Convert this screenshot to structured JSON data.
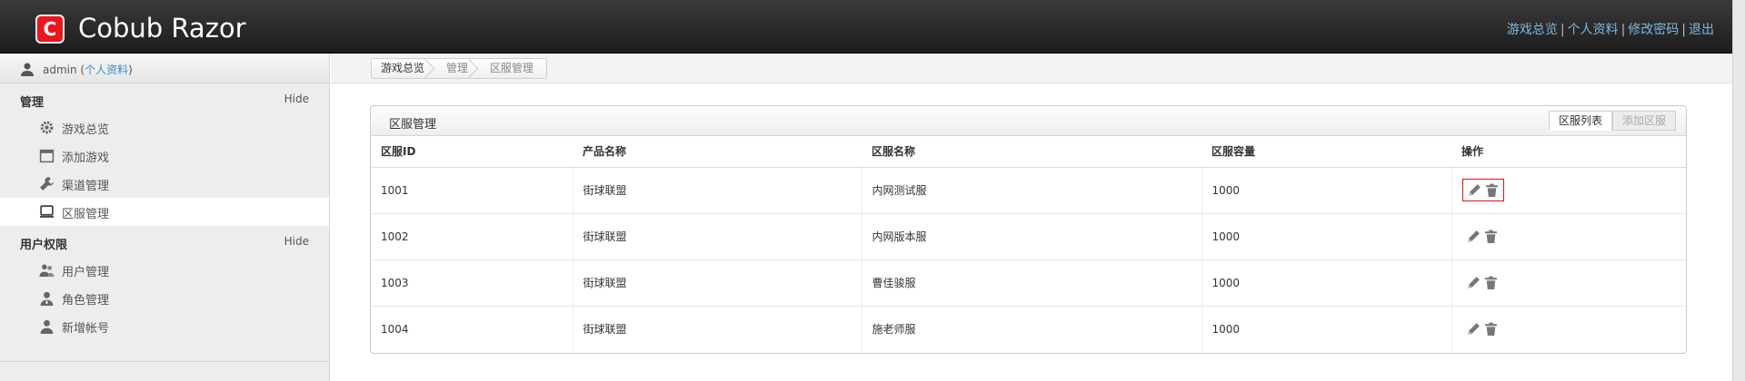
{
  "header": {
    "app_name": "Cobub Razor",
    "links": [
      "游戏总览",
      "个人资料",
      "修改密码",
      "退出"
    ],
    "separator": "|"
  },
  "sidebar": {
    "user": {
      "name": "admin",
      "profile_open": " (",
      "profile_link": "个人资料",
      "profile_close": ")"
    },
    "sections": [
      {
        "title": "管理",
        "hide_label": "Hide",
        "items": [
          {
            "label": "游戏总览",
            "icon": "gear-icon"
          },
          {
            "label": "添加游戏",
            "icon": "calendar-icon"
          },
          {
            "label": "渠道管理",
            "icon": "wrench-icon"
          },
          {
            "label": "区服管理",
            "icon": "monitor-icon",
            "active": true
          }
        ]
      },
      {
        "title": "用户权限",
        "hide_label": "Hide",
        "items": [
          {
            "label": "用户管理",
            "icon": "users-icon"
          },
          {
            "label": "角色管理",
            "icon": "role-icon"
          },
          {
            "label": "新增帐号",
            "icon": "user-add-icon"
          }
        ]
      }
    ]
  },
  "breadcrumb": [
    "游戏总览",
    "管理",
    "区服管理"
  ],
  "panel": {
    "title": "区服管理",
    "tabs": [
      {
        "label": "区服列表",
        "active": true
      },
      {
        "label": "添加区服",
        "active": false
      }
    ],
    "columns": [
      "区服ID",
      "产品名称",
      "区服名称",
      "区服容量",
      "操作"
    ],
    "rows": [
      {
        "id": "1001",
        "product": "街球联盟",
        "name": "内网测试服",
        "capacity": "1000"
      },
      {
        "id": "1002",
        "product": "街球联盟",
        "name": "内网版本服",
        "capacity": "1000"
      },
      {
        "id": "1003",
        "product": "街球联盟",
        "name": "曹佳骏服",
        "capacity": "1000"
      },
      {
        "id": "1004",
        "product": "街球联盟",
        "name": "施老师服",
        "capacity": "1000"
      }
    ],
    "action_icons": [
      "pencil-icon",
      "trash-icon"
    ]
  },
  "colors": {
    "accent_link": "#3a8fc7",
    "header_bg": "#1c1c1c",
    "logo_red": "#e8171e",
    "highlight_red": "#e01010"
  }
}
